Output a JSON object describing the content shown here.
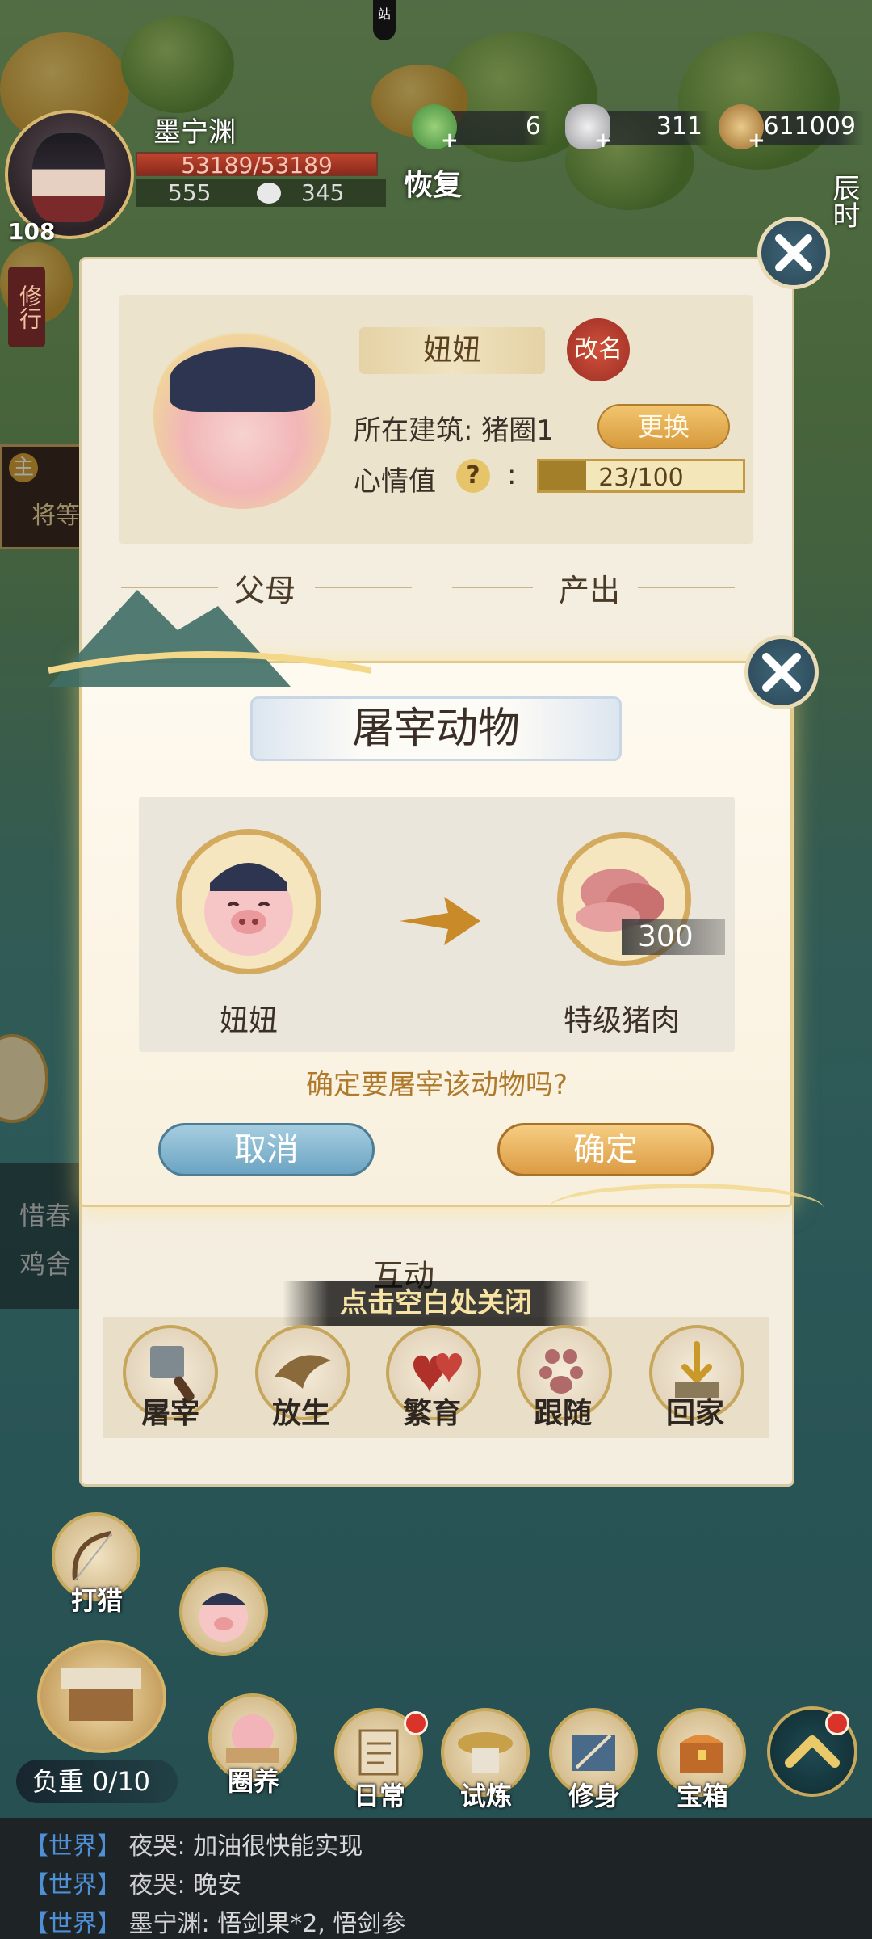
{
  "hud": {
    "station": "站",
    "player_name": "墨宁渊",
    "level": "108",
    "hp": "53189/53189",
    "sub_stat_a": "555",
    "sub_stat_b": "345",
    "recover_label": "恢复",
    "left_tag": "修行",
    "time_label": "辰时",
    "resources": [
      {
        "icon": "jade-icon",
        "value": "6"
      },
      {
        "icon": "silver-ingot-icon",
        "value": "311"
      },
      {
        "icon": "coin-icon",
        "value": "611009"
      }
    ]
  },
  "panel": {
    "animal_name": "妞妞",
    "rename_label": "改名",
    "building_label": "所在建筑: 猪圈1",
    "change_label": "更换",
    "mood_label": "心情值",
    "mood_colon": ":",
    "mood_value": "23/100",
    "mood_fraction": 0.23,
    "parents_title": "父母",
    "output_title": "产出",
    "interact_title": "互动",
    "actions": [
      {
        "icon": "cleaver-icon",
        "label": "屠宰"
      },
      {
        "icon": "bird-icon",
        "label": "放生"
      },
      {
        "icon": "hearts-icon",
        "label": "繁育"
      },
      {
        "icon": "pawprint-icon",
        "label": "跟随"
      },
      {
        "icon": "home-arrow-icon",
        "label": "回家"
      }
    ],
    "close_hint": "点击空白处关闭"
  },
  "dialog": {
    "title": "屠宰动物",
    "from_name": "妞妞",
    "to_name": "特级猪肉",
    "quantity": "300",
    "question": "确定要屠宰该动物吗?",
    "cancel_label": "取消",
    "confirm_label": "确定"
  },
  "side_bg": {
    "left_text_1": "惜春",
    "left_text_2": "鸡舍",
    "mission_tag": "主",
    "mission_text": "将等"
  },
  "bottom": {
    "hunt_label": "打猎",
    "pen_label": "圈养",
    "load_label": "负重 0/10",
    "menu": [
      {
        "icon": "daily-scroll-icon",
        "label": "日常",
        "dot": true
      },
      {
        "icon": "trial-icon",
        "label": "试炼",
        "dot": false
      },
      {
        "icon": "cultivate-icon",
        "label": "修身",
        "dot": false
      },
      {
        "icon": "treasure-chest-icon",
        "label": "宝箱",
        "dot": false
      }
    ]
  },
  "chat": [
    {
      "channel": "【世界】",
      "name": "夜哭:",
      "text": "加油很快能实现"
    },
    {
      "channel": "【世界】",
      "name": "夜哭:",
      "text": "晚安"
    },
    {
      "channel": "【世界】",
      "name": "墨宁渊:",
      "text": "悟剑果*2, 悟剑参"
    }
  ],
  "colors": {
    "accent_gold": "#d79a3d",
    "cancel_blue": "#6ba4c2",
    "hp_red": "#c0452e"
  }
}
